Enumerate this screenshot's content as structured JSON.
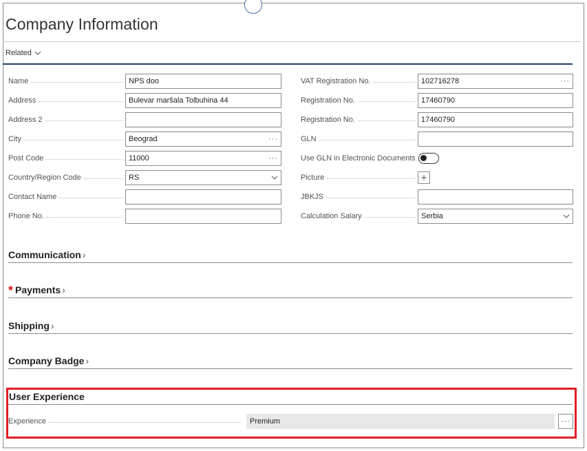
{
  "page": {
    "title": "Company Information"
  },
  "actions": {
    "related_label": "Related"
  },
  "general": {
    "left": [
      {
        "label": "Name",
        "value": "NPS doo",
        "control": "text"
      },
      {
        "label": "Address",
        "value": "Bulevar maršala Tolbuhina 44",
        "control": "text"
      },
      {
        "label": "Address 2",
        "value": "",
        "control": "text"
      },
      {
        "label": "City",
        "value": "Beograd",
        "control": "lookup"
      },
      {
        "label": "Post Code",
        "value": "11000",
        "control": "lookup"
      },
      {
        "label": "Country/Region Code",
        "value": "RS",
        "control": "dropdown"
      },
      {
        "label": "Contact Name",
        "value": "",
        "control": "text"
      },
      {
        "label": "Phone No.",
        "value": "",
        "control": "text"
      }
    ],
    "right": [
      {
        "label": "VAT Registration No.",
        "value": "102716278",
        "control": "lookup"
      },
      {
        "label": "Registration No.",
        "value": "17460790",
        "control": "text"
      },
      {
        "label": "Registration No.",
        "value": "17460790",
        "control": "text"
      },
      {
        "label": "GLN",
        "value": "",
        "control": "text"
      },
      {
        "label": "Use GLN in Electronic Documents",
        "value": "",
        "control": "toggle",
        "toggle_on": false
      },
      {
        "label": "Picture",
        "value": "",
        "control": "picture"
      },
      {
        "label": "JBKJS",
        "value": "",
        "control": "text"
      },
      {
        "label": "Calculation Salary",
        "value": "Serbia",
        "control": "dropdown"
      }
    ]
  },
  "sections": [
    {
      "title": "Communication",
      "required": false
    },
    {
      "title": "Payments",
      "required": true
    },
    {
      "title": "Shipping",
      "required": false
    },
    {
      "title": "Company Badge",
      "required": false
    }
  ],
  "user_experience": {
    "title": "User Experience",
    "field_label": "Experience",
    "field_value": "Premium"
  },
  "colors": {
    "accent_rule": "#1e3f66",
    "highlight": "#e01c24",
    "required": "#d11d1d"
  },
  "icons": {
    "lookup": "ellipsis-icon",
    "dropdown": "chevron-down-icon",
    "picture": "plus-icon",
    "section": "chevron-right-icon"
  }
}
